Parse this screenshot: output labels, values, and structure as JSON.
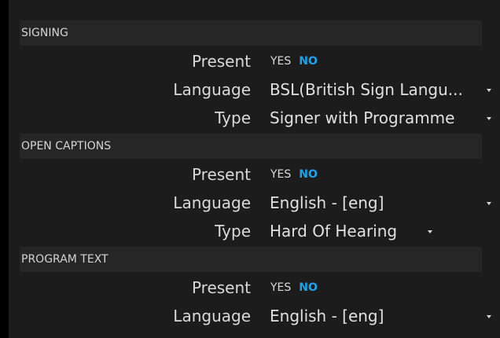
{
  "sections": [
    {
      "header": "SIGNING",
      "present": {
        "label": "Present",
        "yes": "YES",
        "no": "NO"
      },
      "language": {
        "label": "Language",
        "value": "BSL(British Sign Langu..."
      },
      "type": {
        "label": "Type",
        "value": "Signer with Programme"
      }
    },
    {
      "header": "OPEN CAPTIONS",
      "present": {
        "label": "Present",
        "yes": "YES",
        "no": "NO"
      },
      "language": {
        "label": "Language",
        "value": "English - [eng]"
      },
      "type": {
        "label": "Type",
        "value": "Hard Of Hearing"
      }
    },
    {
      "header": "PROGRAM TEXT",
      "present": {
        "label": "Present",
        "yes": "YES",
        "no": "NO"
      },
      "language": {
        "label": "Language",
        "value": "English - [eng]"
      }
    }
  ],
  "icons": {
    "dropdown": "chevron-down-icon"
  },
  "colors": {
    "accent": "#1ea4ea",
    "background": "#1c1c1c",
    "header_bg": "#262626"
  }
}
